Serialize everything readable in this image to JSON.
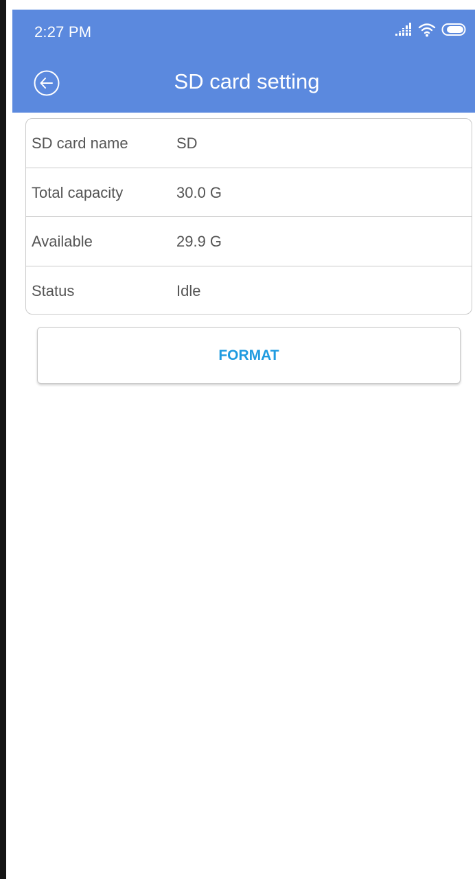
{
  "status_bar": {
    "time": "2:27 PM",
    "icons": [
      "signal-icon",
      "wifi-icon",
      "battery-icon"
    ]
  },
  "app_bar": {
    "title": "SD card setting",
    "back_icon": "back-arrow-circle-icon"
  },
  "sd_info": [
    {
      "label": "SD card name",
      "value": "SD"
    },
    {
      "label": "Total capacity",
      "value": "30.0 G"
    },
    {
      "label": "Available",
      "value": "29.9 G"
    },
    {
      "label": "Status",
      "value": "Idle"
    }
  ],
  "format_button": {
    "label": "FORMAT"
  },
  "colors": {
    "header": "#5b89de",
    "accent": "#1f9be0",
    "text": "#555555",
    "border": "#c9c9c9"
  }
}
